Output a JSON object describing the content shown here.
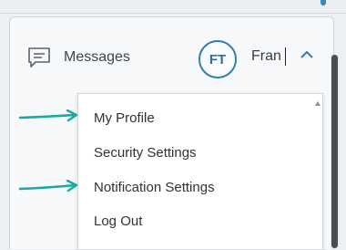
{
  "header": {
    "messages_label": "Messages",
    "messages_icon": "message-square-icon",
    "avatar_initials": "FT",
    "user_name": "Fran",
    "toggle_icon": "chevron-up-icon"
  },
  "dropdown": {
    "items": [
      {
        "label": "My Profile",
        "highlighted": true
      },
      {
        "label": "Security Settings",
        "highlighted": false
      },
      {
        "label": "Notification Settings",
        "highlighted": true
      },
      {
        "label": "Log Out",
        "highlighted": false
      }
    ]
  },
  "colors": {
    "accent": "#2e7fb4",
    "arrow": "#17a9a6"
  }
}
